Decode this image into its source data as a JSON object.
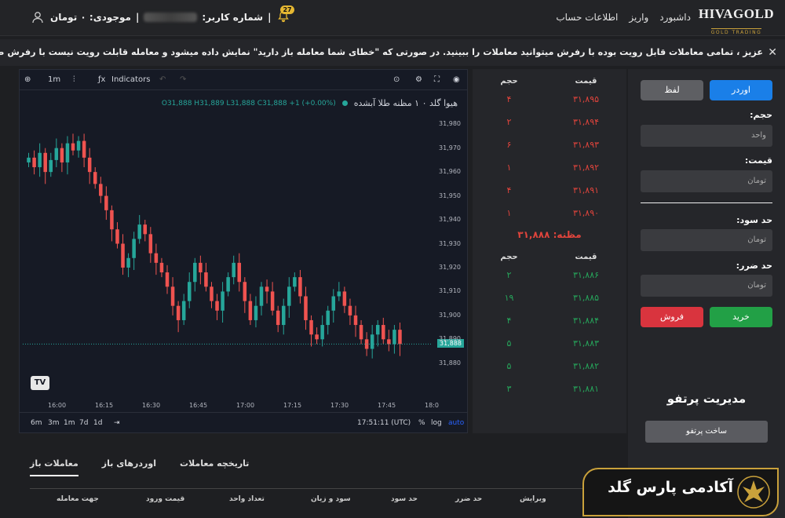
{
  "brand": {
    "title": "HIVAGOLD",
    "subtitle": "GOLD TRADING"
  },
  "nav": [
    "داشبورد",
    "واریز",
    "اطلاعات حساب"
  ],
  "user": {
    "user_label": "شماره کاربر:",
    "balance": "موجودی: ۰ تومان",
    "notifications": "27"
  },
  "ticker": {
    "text": "عزیز ، تمامی معاملات قابل رویت بوده با رفرش میتوانید معاملات را ببینید. در صورتی که \"خطای شما معامله باز دارید\" نمایش داده میشود و معامله قابلت رویت نیست با رفرش صفحه در لحظاتی بعد خطا برطرف",
    "close": "✕"
  },
  "chart_toolbar": {
    "interval": "1m",
    "indicators": "Indicators"
  },
  "symbol": {
    "name": "هیوا گلد ۰ ۱ مظنه طلا آبشده",
    "ohlc": "O31,888 H31,889 L31,888 C31,888 +1 (+0.00%)"
  },
  "price_tag": "31,888",
  "chart_footer": {
    "ranges": [
      "6m",
      "3m",
      "1m",
      "7d",
      "1d"
    ],
    "time": "17:51:11 (UTC)",
    "pct": "%",
    "log": "log",
    "auto": "auto"
  },
  "chart_data": {
    "type": "candlestick",
    "ylim": [
      31875,
      31985
    ],
    "y_ticks": [
      "31,980",
      "31,970",
      "31,960",
      "31,950",
      "31,940",
      "31,930",
      "31,920",
      "31,910",
      "31,900",
      "31,890",
      "31,880"
    ],
    "x_ticks": [
      "16:00",
      "16:15",
      "16:30",
      "16:45",
      "17:00",
      "17:15",
      "17:30",
      "17:45",
      "18:0"
    ],
    "close_series": [
      31966,
      31962,
      31968,
      31960,
      31965,
      31970,
      31964,
      31972,
      31969,
      31973,
      31966,
      31960,
      31955,
      31950,
      31944,
      31936,
      31930,
      31920,
      31924,
      31932,
      31938,
      31934,
      31926,
      31922,
      31918,
      31912,
      31904,
      31898,
      31906,
      31914,
      31922,
      31918,
      31912,
      31906,
      31902,
      31910,
      31916,
      31922,
      31914,
      31906,
      31898,
      31904,
      31912,
      31910,
      31902,
      31896,
      31904,
      31912,
      31916,
      31908,
      31898,
      31892,
      31890,
      31896,
      31902,
      31908,
      31910,
      31904,
      31900,
      31896,
      31890,
      31886,
      31892,
      31896,
      31890,
      31888,
      31894,
      31888
    ],
    "last_price": 31888
  },
  "orderbook": {
    "header": {
      "price": "قیمت",
      "volume": "حجم"
    },
    "asks": [
      {
        "price": "۳۱,۸۹۵",
        "vol": "۴"
      },
      {
        "price": "۳۱,۸۹۴",
        "vol": "۲"
      },
      {
        "price": "۳۱,۸۹۳",
        "vol": "۶"
      },
      {
        "price": "۳۱,۸۹۲",
        "vol": "۱"
      },
      {
        "price": "۳۱,۸۹۱",
        "vol": "۴"
      },
      {
        "price": "۳۱,۸۹۰",
        "vol": "۱"
      }
    ],
    "mid": "مظنه: ۳۱,۸۸۸",
    "bids": [
      {
        "price": "۳۱,۸۸۶",
        "vol": "۲"
      },
      {
        "price": "۳۱,۸۸۵",
        "vol": "۱۹"
      },
      {
        "price": "۳۱,۸۸۴",
        "vol": "۴"
      },
      {
        "price": "۳۱,۸۸۳",
        "vol": "۵"
      },
      {
        "price": "۳۱,۸۸۲",
        "vol": "۵"
      },
      {
        "price": "۳۱,۸۸۱",
        "vol": "۳"
      }
    ]
  },
  "order_panel": {
    "tab_order": "اوردر",
    "tab_lafz": "لفظ",
    "volume_label": "حجم:",
    "volume_placeholder": "واحد",
    "price_label": "قیمت:",
    "price_placeholder": "تومان",
    "tp_label": "حد سود:",
    "tp_placeholder": "تومان",
    "sl_label": "حد ضرر:",
    "sl_placeholder": "تومان",
    "buy": "خرید",
    "sell": "فروش",
    "portfolio_title": "مدیریت پرتفو",
    "portfolio_btn": "ساخت پرتفو"
  },
  "bottom_tabs": [
    "معاملات باز",
    "اوردرهای باز",
    "تاریخچه معاملات"
  ],
  "table_headers": [
    "جهت معامله",
    "قیمت ورود",
    "تعداد واحد",
    "سود و زیان",
    "حد سود",
    "حد ضرر",
    "ویرایش"
  ],
  "promo": {
    "text": "آکادمی پارس گلد"
  },
  "colors": {
    "up": "#26a69a",
    "down": "#ef5350",
    "buy_btn": "#22a046",
    "sell_btn": "#d9343e",
    "order_tab": "#1a7fe8"
  }
}
